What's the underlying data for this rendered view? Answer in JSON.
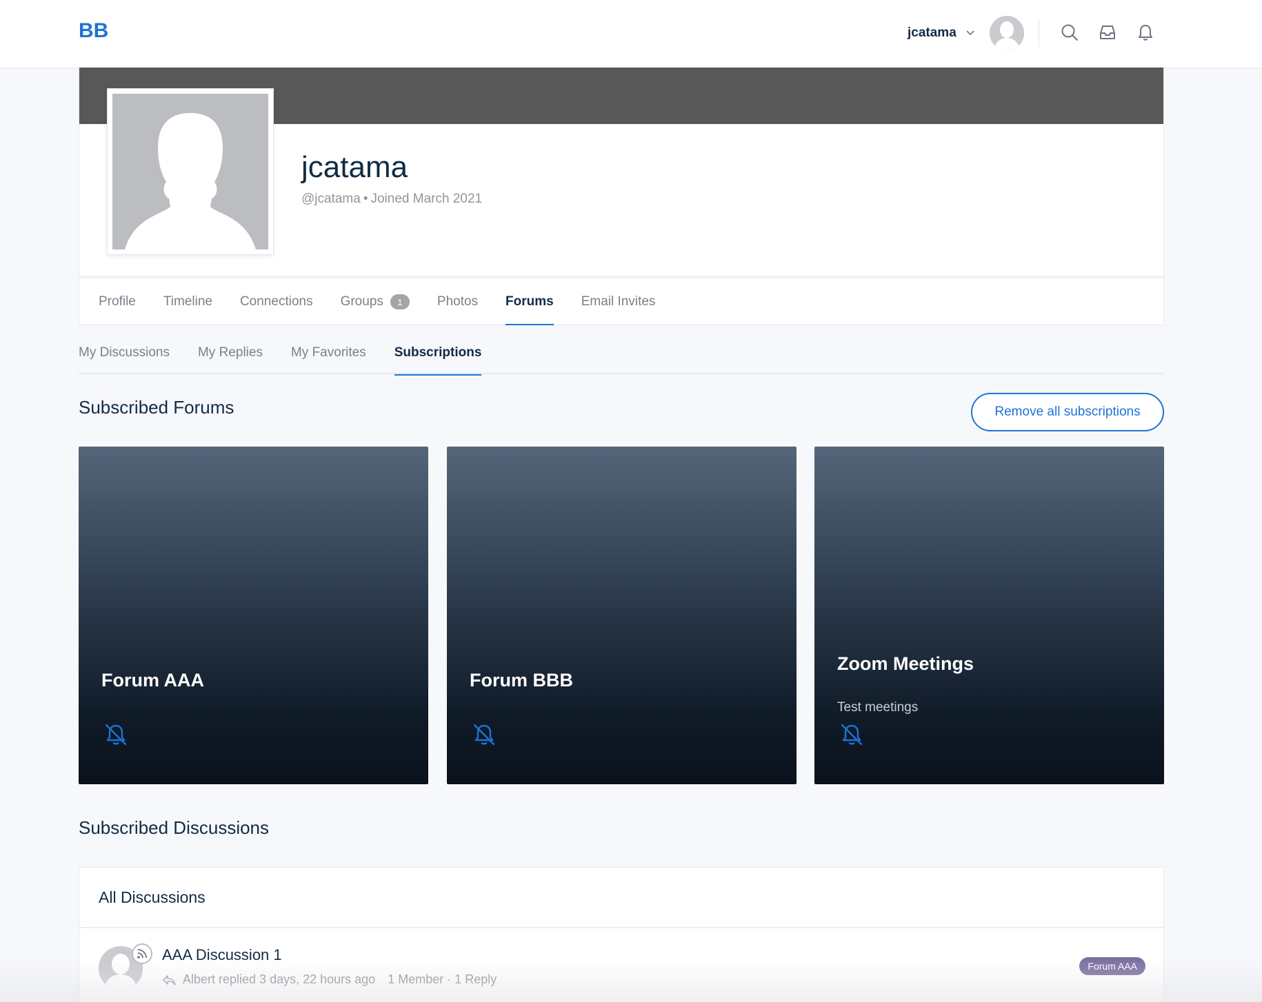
{
  "header": {
    "logo": "BB",
    "username": "jcatama",
    "icons": [
      "search-icon",
      "inbox-icon",
      "bell-icon"
    ]
  },
  "profile": {
    "display_name": "jcatama",
    "handle": "@jcatama",
    "joined": "Joined March 2021"
  },
  "profile_nav": {
    "items": [
      {
        "label": "Profile"
      },
      {
        "label": "Timeline"
      },
      {
        "label": "Connections"
      },
      {
        "label": "Groups",
        "count": "1"
      },
      {
        "label": "Photos"
      },
      {
        "label": "Forums",
        "active": true
      },
      {
        "label": "Email Invites"
      }
    ]
  },
  "sub_nav": {
    "items": [
      {
        "label": "My Discussions"
      },
      {
        "label": "My Replies"
      },
      {
        "label": "My Favorites"
      },
      {
        "label": "Subscriptions",
        "active": true
      }
    ]
  },
  "subscribed_forums": {
    "title": "Subscribed Forums",
    "remove_all_label": "Remove all subscriptions",
    "forums": [
      {
        "title": "Forum AAA",
        "description": ""
      },
      {
        "title": "Forum BBB",
        "description": ""
      },
      {
        "title": "Zoom Meetings",
        "description": "Test meetings"
      }
    ]
  },
  "subscribed_discussions": {
    "title": "Subscribed Discussions",
    "panel_title": "All Discussions",
    "items": [
      {
        "title": "AAA Discussion 1",
        "reply_info": "Albert replied 3 days, 22 hours ago",
        "members": "1 Member",
        "replies": "1 Reply",
        "separator": "·",
        "forum_tag": "Forum AAA"
      }
    ]
  },
  "colors": {
    "accent": "#1e73d6",
    "text_primary": "#122b46",
    "text_muted": "#939597",
    "forum_tag": "#7b6e9e"
  }
}
